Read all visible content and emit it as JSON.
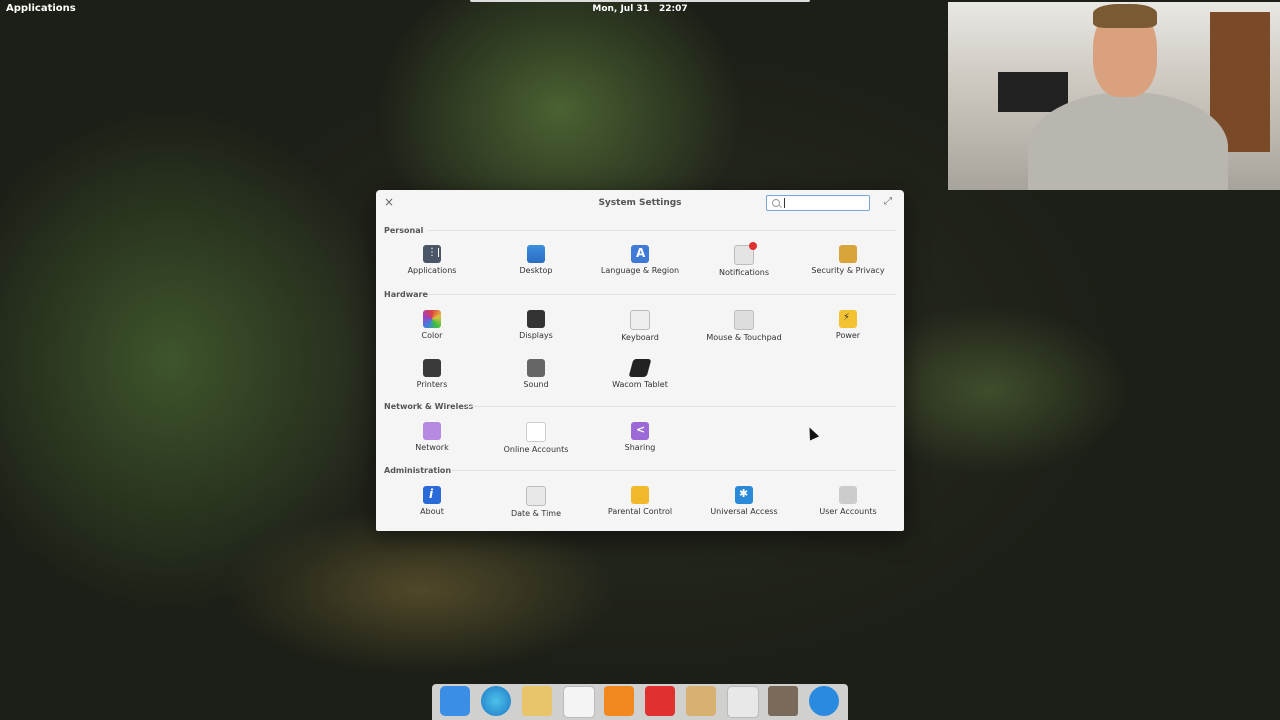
{
  "panel": {
    "applications_label": "Applications",
    "date": "Mon, Jul 31",
    "time": "22:07"
  },
  "window": {
    "title": "System Settings",
    "search_value": "",
    "sections": {
      "personal": {
        "heading": "Personal",
        "items": [
          "Applications",
          "Desktop",
          "Language & Region",
          "Notifications",
          "Security & Privacy"
        ]
      },
      "hardware": {
        "heading": "Hardware",
        "items": [
          "Color",
          "Displays",
          "Keyboard",
          "Mouse & Touchpad",
          "Power",
          "Printers",
          "Sound",
          "Wacom Tablet"
        ]
      },
      "network": {
        "heading": "Network & Wireless",
        "items": [
          "Network",
          "Online Accounts",
          "Sharing"
        ]
      },
      "administration": {
        "heading": "Administration",
        "items": [
          "About",
          "Date & Time",
          "Parental Control",
          "Universal Access",
          "User Accounts"
        ]
      }
    }
  },
  "dock": {
    "icons": [
      "multitasking-view-icon",
      "web-browser-icon",
      "mail-icon",
      "calendar-icon",
      "music-icon",
      "videos-icon",
      "photos-icon",
      "system-settings-icon",
      "app-center-icon",
      "updates-icon"
    ]
  },
  "colors": {
    "accent": "#3d8fe0",
    "window_bg": "#f5f5f5",
    "panel_text": "#ffffff"
  }
}
